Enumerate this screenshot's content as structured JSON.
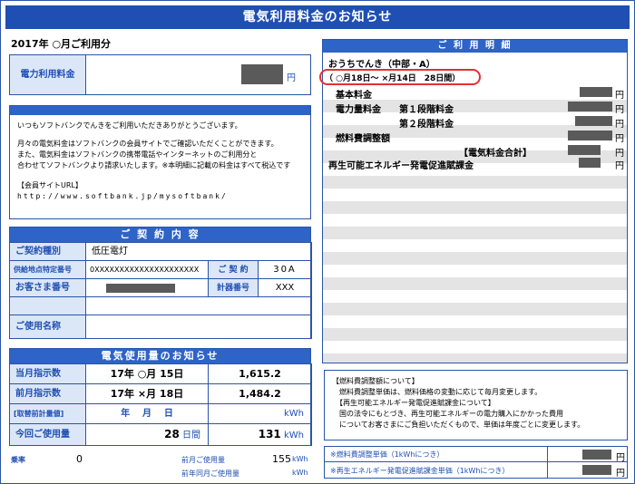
{
  "title": "電気利用料金のお知らせ",
  "period": "2017年 ○月ご利用分",
  "charge": {
    "label": "電力利用料金",
    "unit": "円"
  },
  "message": {
    "line1": "いつもソフトバンクでんきをご利用いただきありがとうございます。",
    "line2": "月々の電気料金はソフトバンクの会員サイトでご確認いただくことができます。",
    "line3": "また、電気料金はソフトバンクの携帯電話やインターネットのご利用分と",
    "line4": "合わせてソフトバンクより請求いたします。※本明細に記載の料金はすべて税込です",
    "site_label": "【会員サイトURL】",
    "site_url": "http://www.softbank.jp/mysoftbank/"
  },
  "contract": {
    "header": "ご 契 約 内 容",
    "type_label": "ご契約種別",
    "type_value": "低圧電灯",
    "point_label": "供給地点特定番号",
    "point_value": "0XXXXXXXXXXXXXXXXXXXXX",
    "contract_label": "ご 契 約",
    "contract_value": "30A",
    "customer_label": "お客さま番号",
    "meter_label": "計器番号",
    "meter_value": "XXX",
    "user_label": "ご使用名称"
  },
  "usage": {
    "header": "電気使用量のお知らせ",
    "current_label": "当月指示数",
    "current_date": "17年 ○月 15日",
    "current_value": "1,615.2",
    "previous_label": "前月指示数",
    "previous_date": "17年 ×月 18日",
    "previous_value": "1,484.2",
    "replace_label": "[取替前計量値]",
    "replace_date": "年    月    日",
    "replace_unit": "kWh",
    "this_label": "今回ご使用量",
    "this_days": "28",
    "this_days_unit": "日間",
    "this_value": "131",
    "this_unit": "kWh"
  },
  "footer": {
    "rate_label": "乗率",
    "rate_value": "0",
    "prev_usage_label": "前月ご使用量",
    "prev_usage_value": "155",
    "prev_usage_unit": "kWh",
    "last_year_label": "前年同月ご使用量",
    "last_year_unit": "kWh"
  },
  "details": {
    "header": "ご 利 用 明 細",
    "plan": "おうちでんき（中部・A）",
    "range": "（ ○月18日～ ×月14日　28日間）",
    "base": "基本料金",
    "energy": "電力量料金",
    "stage1": "第１段階料金",
    "stage2": "第２段階料金",
    "fuel": "燃料費調整額",
    "total": "【電気料金合計】",
    "renew": "再生可能エネルギー発電促進賦課金",
    "yen": "円"
  },
  "notes": {
    "fuel_title": "【燃料費調整額について】",
    "fuel_text": "燃料費調整単価は、燃料価格の変動に応じて毎月変更します。",
    "renew_title": "【再生可能エネルギー発電促進賦課金について】",
    "renew_text1": "国の法令にもとづき、再生可能エネルギーの電力購入にかかった費用",
    "renew_text2": "についてお客さまにご負担いただくもので、単価は年度ごとに変更します。"
  },
  "unit_rates": {
    "fuel_label": "※燃料費調整単価（1kWhにつき）",
    "renew_label": "※再生エネルギー発電促進賦課金単価（1kWhにつき）",
    "yen": "円"
  },
  "colors": {
    "primary": "#1f4fb3",
    "highlight": "#e53030"
  }
}
